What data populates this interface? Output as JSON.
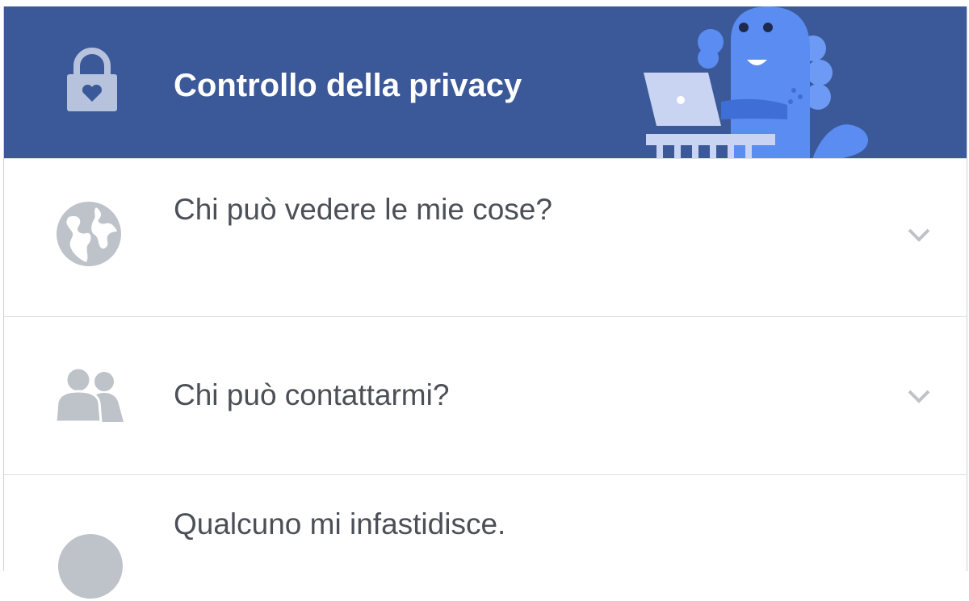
{
  "header": {
    "title": "Controllo della privacy",
    "background_color": "#3b5998",
    "lock_icon": "lock-heart-icon",
    "mascot": "privacy-dinosaur-illustration"
  },
  "items": [
    {
      "label": "Chi può vedere le mie cose?",
      "icon": "globe-icon",
      "expanded": false
    },
    {
      "label": "Chi può contattarmi?",
      "icon": "people-icon",
      "expanded": false
    },
    {
      "label": "Qualcuno mi infastidisce.",
      "icon": "blocked-icon",
      "expanded": false
    }
  ],
  "colors": {
    "brand": "#3b5998",
    "icon_gray": "#bec3c9",
    "text": "#4b4f56",
    "mascot_blue": "#5b8cf2"
  }
}
